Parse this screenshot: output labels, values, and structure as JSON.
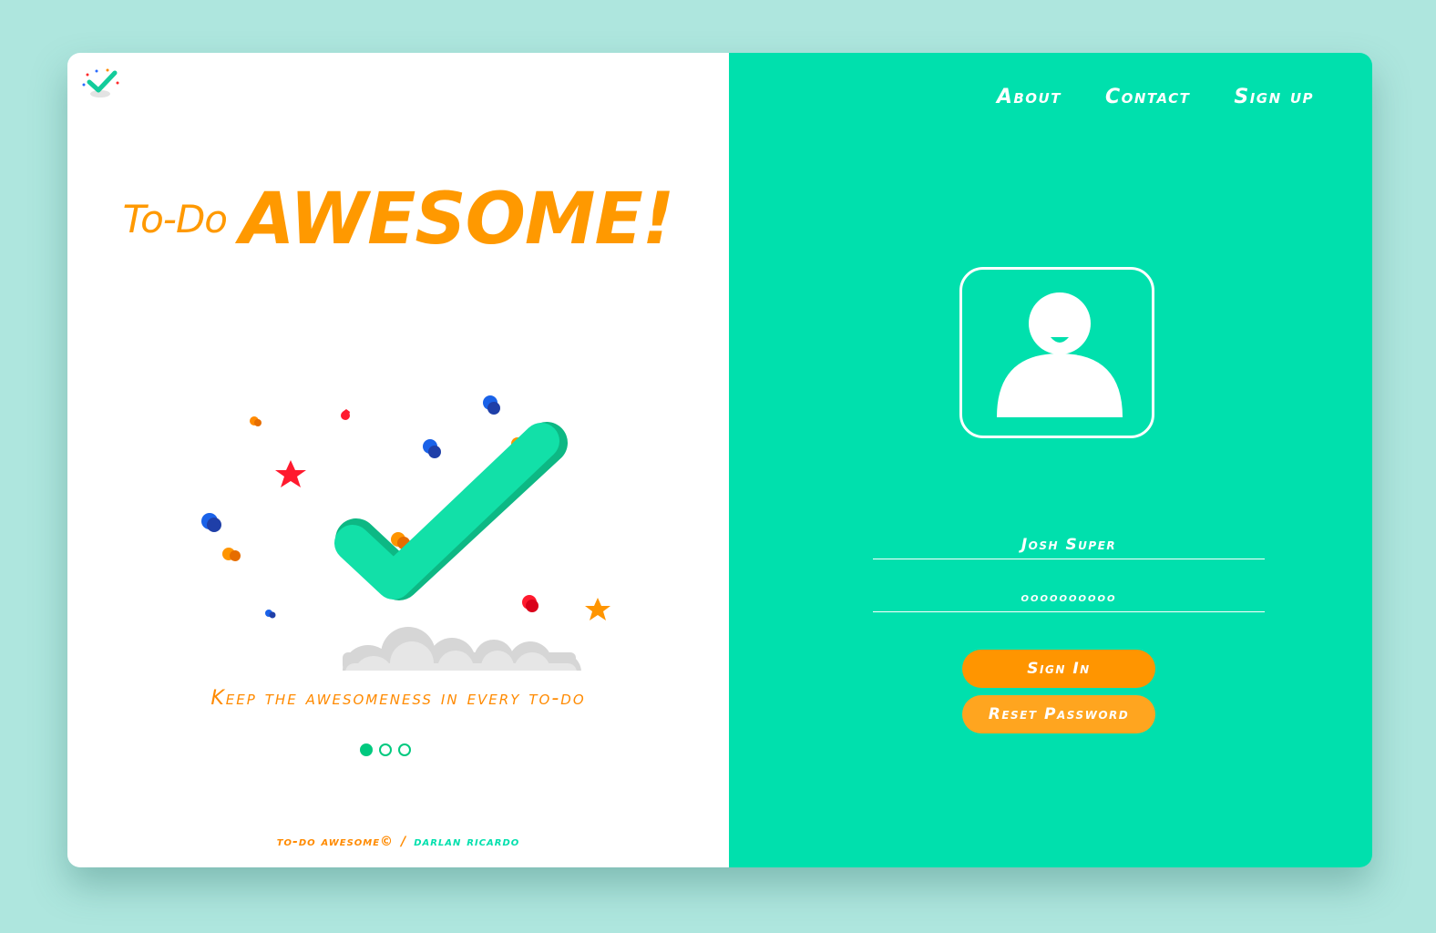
{
  "brand": {
    "title_small": "To-Do",
    "title_big": "AWESOME!",
    "tagline": "Keep the awesomeness in every to-do",
    "footer_copy": "to-do awesome©",
    "footer_sep": "/",
    "footer_author": "darlan ricardo"
  },
  "carousel": {
    "slides": 3,
    "active": 1
  },
  "nav": {
    "about": "About",
    "contact": "Contact",
    "signup": "Sign up"
  },
  "login": {
    "username_value": "Josh Super",
    "password_value": "oooooooooo",
    "signin_label": "Sign In",
    "reset_label": "Reset Password"
  },
  "colors": {
    "accent_green": "#00e0ad",
    "orange": "#ff9500",
    "background": "#aee6de"
  }
}
